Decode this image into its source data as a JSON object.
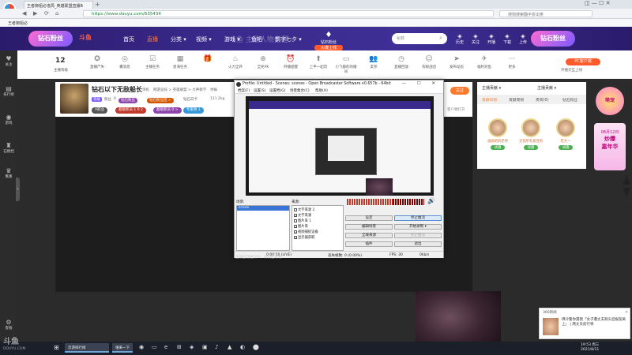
{
  "browser": {
    "tab_title": "王者御姐必逢局_英雄联盟直播B",
    "url": "https://www.douyu.com/635434",
    "search_placeholder": "搜狗搜索翻半折出笑",
    "bookmark": "王者御姐必",
    "sys_buttons": "◫ — ☐ ✕",
    "nav_back": "◀",
    "nav_forward": "▶",
    "nav_reload": "⟳",
    "nav_home": "⌂"
  },
  "header": {
    "logo_text": "钻石粉丝",
    "logo2_text": "斗鱼",
    "watermark": "斗鱼 主播人物生涯",
    "nav": [
      {
        "label": "首页",
        "active": false
      },
      {
        "label": "直播",
        "active": true
      },
      {
        "label": "分类 ▾",
        "active": false
      },
      {
        "label": "视频 ▾",
        "active": false
      },
      {
        "label": "游戏 ▾",
        "active": false
      },
      {
        "label": "鱼吧",
        "active": false
      },
      {
        "label": "鹊字七夕 ▾",
        "active": false
      }
    ],
    "promo_top": "钻石粉丝",
    "promo_bottom": "火爆上线",
    "search_placeholder": "秘籍",
    "icons": [
      {
        "name": "history",
        "label": "历史"
      },
      {
        "name": "follow",
        "label": "关注"
      },
      {
        "name": "open",
        "label": "开播"
      },
      {
        "name": "upload",
        "label": "下载"
      },
      {
        "name": "download",
        "label": "上传"
      }
    ],
    "right_badge": "钻石粉丝"
  },
  "sidebar": {
    "items": [
      {
        "icon": "♥",
        "label": "关注"
      },
      {
        "icon": "▤",
        "label": "排行榜"
      },
      {
        "icon": "◉",
        "label": "游戏"
      },
      {
        "icon": "♜",
        "label": "石榴档"
      },
      {
        "icon": "♛",
        "label": "鹰寨"
      },
      {
        "icon": "⚙",
        "label": "客服"
      }
    ],
    "toggle": "›"
  },
  "toolbar": {
    "level": "12",
    "level_label": "主播等级",
    "items": [
      {
        "icon": "✪",
        "label": "直播尸失"
      },
      {
        "icon": "◎",
        "label": "撒消息"
      },
      {
        "icon": "☑",
        "label": "主播任务"
      },
      {
        "icon": "▦",
        "label": "星海任务"
      },
      {
        "icon": "🎁",
        "label": ""
      },
      {
        "icon": "♨",
        "label": "火力全开"
      },
      {
        "icon": "⊕",
        "label": "全民PK"
      },
      {
        "icon": "⏰",
        "label": "开播提醒"
      },
      {
        "icon": "⬆",
        "label": "上半一起玩"
      },
      {
        "icon": "▭",
        "label": "小飞服的的播间"
      },
      {
        "icon": "👥",
        "label": "友邦"
      },
      {
        "icon": "◷",
        "label": "直播回放"
      },
      {
        "icon": "☺",
        "label": "有眼战团"
      },
      {
        "icon": "➤",
        "label": "发布动态"
      },
      {
        "icon": "✈",
        "label": "福利对鱼"
      },
      {
        "icon": "⋯",
        "label": "更多"
      }
    ],
    "pc_client": "PC客户端",
    "pc_sub": "开播交互上线"
  },
  "streamer": {
    "title": "钻石以下无敌船长",
    "category": "单机",
    "breadcrumb": "网游竞技 > 英雄联盟 > 大神教学",
    "report": "举报",
    "badge_label": "等级",
    "fans_count": "0",
    "fans_label": "粉丝",
    "rank_text": "钻石日卡",
    "heat": "111.2kg",
    "chips": [
      {
        "label": "钻石粉丝",
        "color": "#8e44ad"
      },
      {
        "label": "钻石粉丝团 >",
        "color": "#d35400"
      }
    ],
    "row3": [
      {
        "label": "V职业",
        "color": "#555"
      },
      {
        "label": "超级新员 1 0 2",
        "color": "#c0392b"
      },
      {
        "label": "超级新员 0 >",
        "color": "#8e44ad"
      },
      {
        "label": "专家称 1",
        "color": "#3498db"
      }
    ],
    "follow": "关注",
    "client_watch": "客户端打开"
  },
  "right_panel": {
    "header_left": "主播贡献 ▾",
    "header_right": "主播贡献 ▾",
    "tabs": [
      "贡献日榜",
      "贡献周榜",
      "贵宾(0)",
      "钻石粉丝"
    ],
    "ranks": [
      {
        "name": "画画的的老师",
        "pill": "试播"
      },
      {
        "name": "无忧所有直连的",
        "pill": "试播"
      },
      {
        "name": "花大一",
        "pill": "试播"
      }
    ]
  },
  "right_ad": {
    "ad1": "萌宠",
    "ad2_line1": "08月12日",
    "ad2_line2": "炒爆",
    "ad2_line3": "嘉年华"
  },
  "obs": {
    "title": "Profile: Untitled - Scenes: scenes - Open Broadcaster Software v0.657b - 64bit",
    "win_buttons": "— ☐ ✕",
    "menu": [
      "档案(F)",
      "设置(S)",
      "设置档(G)",
      "场景集合(C)",
      "帮助(H)"
    ],
    "scenes_label": "场景:",
    "sources_label": "来源:",
    "scene_selected": "scene",
    "sources": [
      {
        "label": "文字来源 2",
        "checked": false
      },
      {
        "label": "文字来源",
        "checked": true
      },
      {
        "label": "图片来 1",
        "checked": false
      },
      {
        "label": "图片来",
        "checked": true
      },
      {
        "label": "视频捕捉设备",
        "checked": true
      },
      {
        "label": "显示器获取",
        "checked": true
      }
    ],
    "buttons_left": [
      "设定",
      "编辑场景",
      "全域来源",
      "插件"
    ],
    "buttons_right": [
      "停止推流",
      "开始录制 ▾",
      "停止推流",
      "退出"
    ],
    "status_time": "0:00:50 (LIVE)",
    "status_dropped": "丢失帧数: 0 (0.00%)",
    "status_fps": "FPS: 30",
    "status_bitrate": "0kb/s",
    "speaker_icon": "🔊",
    "under_text": "主播正在推流中，请稍后观看"
  },
  "notification": {
    "app": "360新闻",
    "text": "佛冷警你遇我「女子遭丈夫剃头后报案离上」 | 两丈夫前行将",
    "close": "✕"
  },
  "taskbar": {
    "start": "⊞",
    "task1": "页游排行榜",
    "task2": "谁来一下",
    "time": "19:53 周三",
    "date": "2021/8/11",
    "icons": [
      "◉",
      "▭",
      "e",
      "⊞",
      "◈",
      "▣",
      "♪",
      "▲",
      "◐",
      "⬤"
    ]
  },
  "watermark": {
    "big": "斗鱼",
    "small": "DOUYU.COM"
  }
}
